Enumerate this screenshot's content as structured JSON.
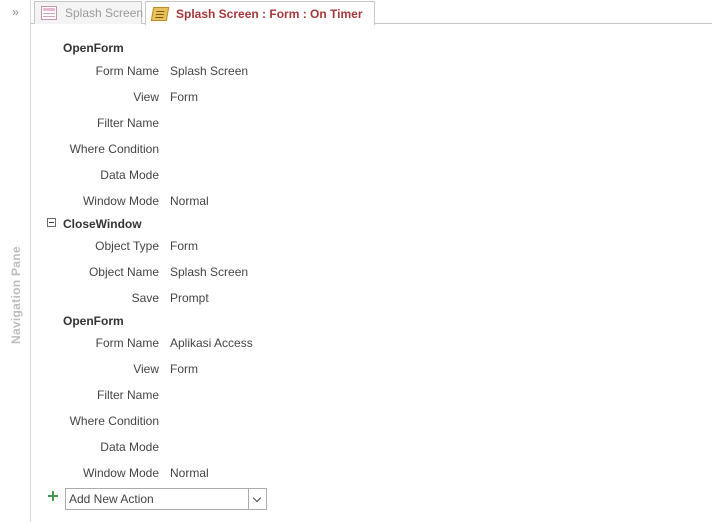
{
  "nav_pane": {
    "toggle_glyph": "»",
    "label": "Navigation Pane"
  },
  "tabs": [
    {
      "label": "Splash Screen",
      "icon": "form-icon",
      "active": false
    },
    {
      "label": "Splash Screen : Form : On Timer",
      "icon": "macro-icon",
      "active": true
    }
  ],
  "actions": [
    {
      "name": "OpenForm",
      "arguments": [
        {
          "label": "Form Name",
          "value": "Splash Screen"
        },
        {
          "label": "View",
          "value": "Form"
        },
        {
          "label": "Filter Name",
          "value": ""
        },
        {
          "label": "Where Condition",
          "value": ""
        },
        {
          "label": "Data Mode",
          "value": ""
        },
        {
          "label": "Window Mode",
          "value": "Normal"
        }
      ]
    },
    {
      "name": "CloseWindow",
      "arguments": [
        {
          "label": "Object Type",
          "value": "Form"
        },
        {
          "label": "Object Name",
          "value": "Splash Screen"
        },
        {
          "label": "Save",
          "value": "Prompt"
        }
      ]
    },
    {
      "name": "OpenForm",
      "arguments": [
        {
          "label": "Form Name",
          "value": "Aplikasi Access"
        },
        {
          "label": "View",
          "value": "Form"
        },
        {
          "label": "Filter Name",
          "value": ""
        },
        {
          "label": "Where Condition",
          "value": ""
        },
        {
          "label": "Data Mode",
          "value": ""
        },
        {
          "label": "Window Mode",
          "value": "Normal"
        }
      ]
    }
  ],
  "add_new_action": {
    "label": "Add New Action",
    "plus_icon": "plus-icon",
    "dropdown_icon": "chevron-down-icon"
  },
  "colors": {
    "active_tab_text": "#a4373a",
    "inactive_tab_text": "#9a9a9a",
    "nav_label": "#bdbdbd",
    "add_plus": "#3f9a4a"
  }
}
